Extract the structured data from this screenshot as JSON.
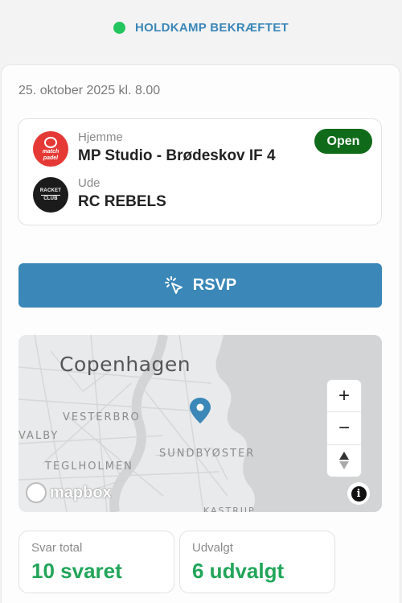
{
  "status": {
    "text": "HOLDKAMP BEKRÆFTET",
    "dot_color": "#22c55e"
  },
  "match": {
    "date": "25. oktober 2025 kl. 8.00",
    "badge": "Open",
    "home": {
      "role": "Hjemme",
      "name": "MP Studio - Brødeskov IF 4",
      "logo_text": "match padel",
      "logo_color": "#e53935"
    },
    "away": {
      "role": "Ude",
      "name": "RC REBELS",
      "logo_text_top": "RACKET",
      "logo_text_bottom": "CLUB",
      "logo_color": "#1b1b1b"
    }
  },
  "rsvp": {
    "label": "RSVP",
    "icon": "cursor-click-icon",
    "color": "#3a87b8"
  },
  "map": {
    "city": "Copenhagen",
    "labels": {
      "vesterbro": "VESTERBRO",
      "valby": "VALBY",
      "sundbyoster": "SUNDBYØSTER",
      "teglholmen": "TEGLHOLMEN",
      "kastrup": "KASTRUP"
    },
    "zoom_in": "+",
    "zoom_out": "−",
    "compass": "▲",
    "attribution": "mapbox",
    "info": "i"
  },
  "stats": {
    "total": {
      "label": "Svar total",
      "value": "10 svaret"
    },
    "selected": {
      "label": "Udvalgt",
      "value": "6 udvalgt"
    }
  }
}
